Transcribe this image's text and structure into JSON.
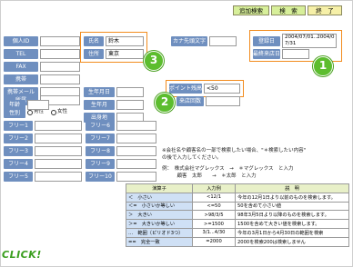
{
  "toolbar": {
    "add_search": "追加検索",
    "search": "検　索",
    "end": "終　了"
  },
  "fields": {
    "personal_id": {
      "label": "個人ID",
      "value": ""
    },
    "tel": {
      "label": "TEL",
      "value": ""
    },
    "fax": {
      "label": "FAX",
      "value": ""
    },
    "mobile": {
      "label": "携帯",
      "value": ""
    },
    "mobile_mail": {
      "label": "携帯メール",
      "value": ""
    },
    "work": {
      "label": "所属",
      "value": ""
    },
    "gender": {
      "label": "性別",
      "male": "男性",
      "female": "女性"
    },
    "name": {
      "label": "氏名",
      "value": "鈴木"
    },
    "address": {
      "label": "住所",
      "value": "東京"
    },
    "kana": {
      "label": "カナ先頭文字",
      "value": ""
    },
    "birth_date": {
      "label": "生年月日",
      "value": ""
    },
    "birth_month": {
      "label": "生年月",
      "value": ""
    },
    "age": {
      "label": "年齢",
      "value": ""
    },
    "hometown": {
      "label": "出身地",
      "value": ""
    },
    "points": {
      "label": "ポイント残高",
      "value": "<50"
    },
    "count": {
      "label": "来店回数",
      "value": ""
    },
    "reg_date": {
      "label": "登録日",
      "value": "2004/07/01..2004/07/31"
    },
    "last_visit": {
      "label": "最終来店日",
      "value": ""
    }
  },
  "free_fields": {
    "left": [
      "フリー1",
      "フリー2",
      "フリー3",
      "フリー4",
      "フリー5"
    ],
    "right": [
      "フリー6",
      "フリー7",
      "フリー8",
      "フリー9",
      "フリー10"
    ]
  },
  "notes": {
    "line1": "※会社名や顧客名の一部で検索したい場合、\"＊検索したい内容\"",
    "line2": "の後で入力してください。",
    "line3": "例：　株式会社マグレックス　→　＊マグレックス　と入力",
    "line4": "　　　顧客　太郎　　→　＊太郎　と入力"
  },
  "operators_table": {
    "headers": [
      "演算子",
      "入力例",
      "説　明"
    ],
    "rows": [
      {
        "op": "＜　小さい",
        "example": "<12/1",
        "desc": "今年の12月1日より以前のものを検索します。"
      },
      {
        "op": "＜=　小さいか等しい",
        "example": "<=50",
        "desc": "50を含めて小さい値"
      },
      {
        "op": "＞　大きい",
        "example": ">98/3/5",
        "desc": "98年3月5日より以降のものを検索します。"
      },
      {
        "op": "＞=　大きいか等しい",
        "example": ">=1500",
        "desc": "1500を含めて大きい値を検索します。"
      },
      {
        "op": "…　範囲（ピリオド3つ）",
        "example": "3/1...4/30",
        "desc": "今年の3月1日から4月30日の範囲を検索"
      },
      {
        "op": "==　完全一致",
        "example": "=2000",
        "desc": "2000を検索200は検索しません"
      }
    ]
  },
  "badges": {
    "one": "1",
    "two": "2",
    "three": "3"
  },
  "click_text": "CLICK!",
  "colors": {
    "label_blue": "#6f8fbf",
    "highlight_orange": "#f28c1e",
    "badge_green": "#5cbd2e",
    "button_green": "#d7ef9a",
    "button_yellow": "#f6f0a8"
  }
}
